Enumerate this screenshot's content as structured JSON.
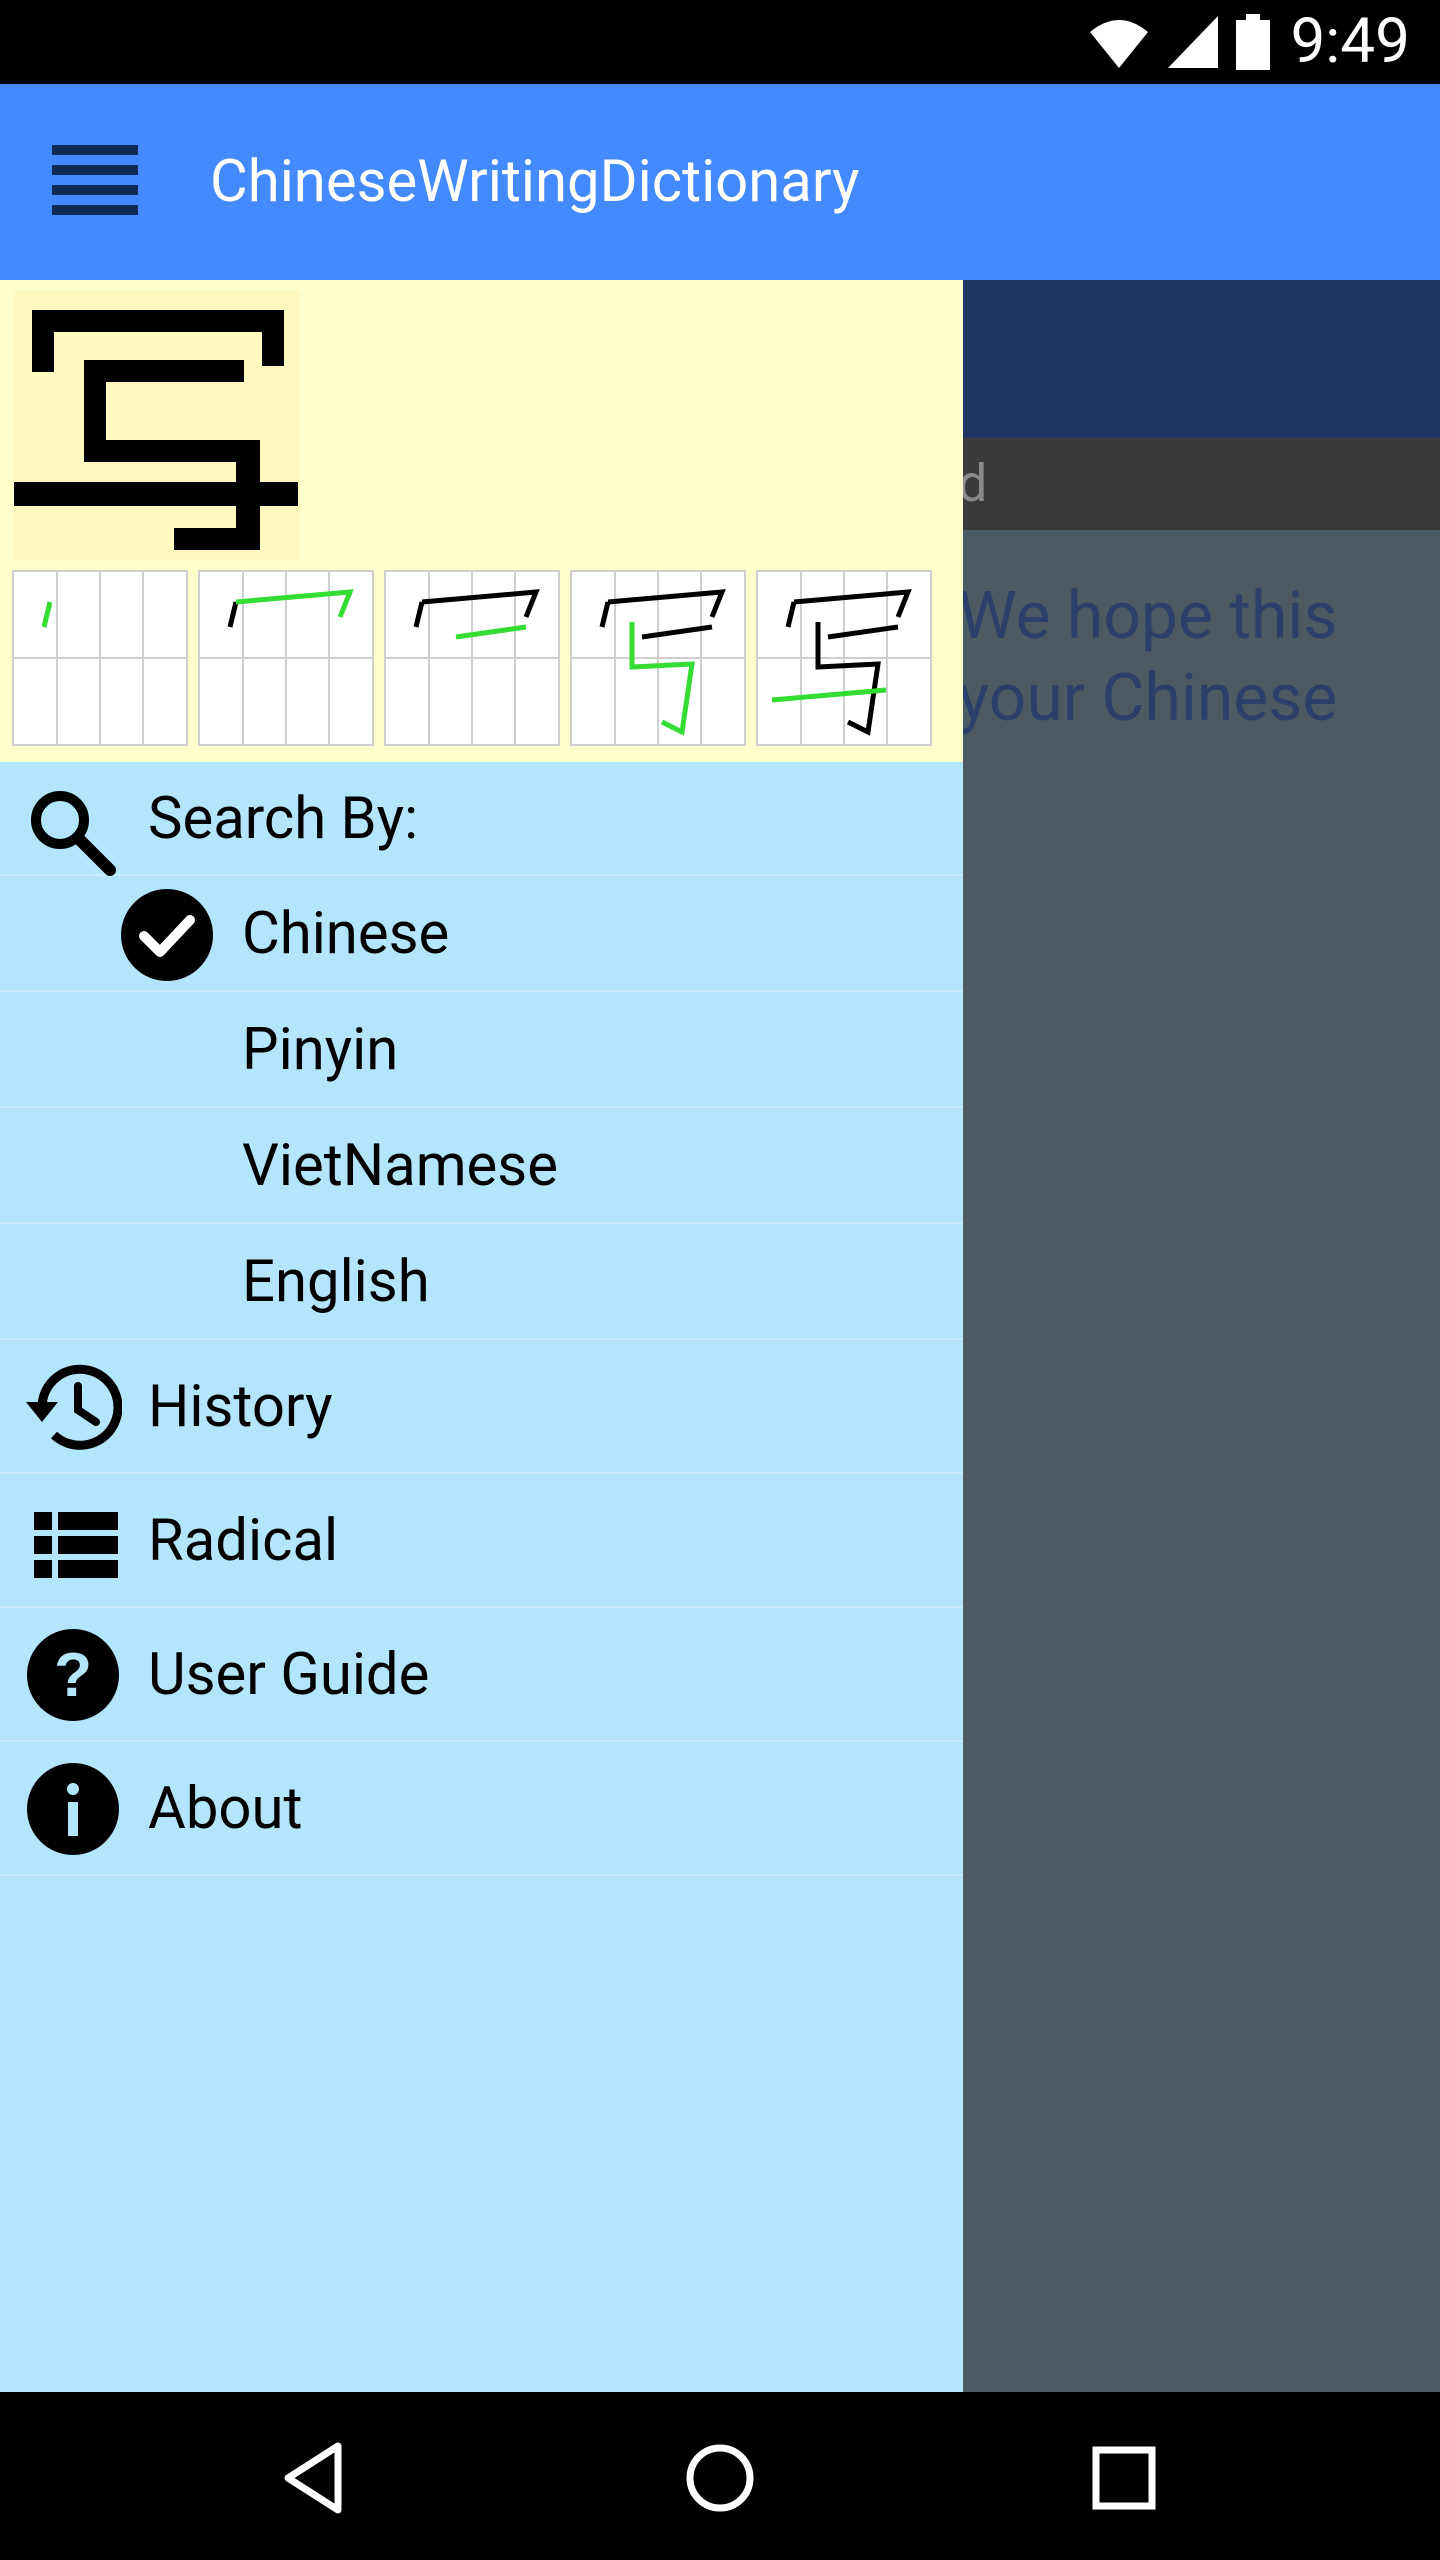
{
  "status_bar": {
    "time": "9:49"
  },
  "app_bar": {
    "title": "ChineseWritingDictionary"
  },
  "background_content": {
    "search_placeholder": "d",
    "welcome_line1": "We hope this",
    "welcome_line2": "your Chinese"
  },
  "drawer": {
    "header": {
      "character": "写"
    },
    "search_by": {
      "label": "Search By:",
      "options": [
        {
          "label": "Chinese",
          "selected": true
        },
        {
          "label": "Pinyin",
          "selected": false
        },
        {
          "label": "VietNamese",
          "selected": false
        },
        {
          "label": "English",
          "selected": false
        }
      ]
    },
    "items": [
      {
        "label": "History",
        "icon": "history-icon"
      },
      {
        "label": "Radical",
        "icon": "list-icon"
      },
      {
        "label": "User Guide",
        "icon": "help-icon"
      },
      {
        "label": "About",
        "icon": "info-icon"
      }
    ]
  },
  "colors": {
    "app_bar": "#448aff",
    "drawer_bg": "#b3e5fc",
    "drawer_header_bg": "#ffffcc",
    "stroke_highlight": "#33dd33"
  }
}
